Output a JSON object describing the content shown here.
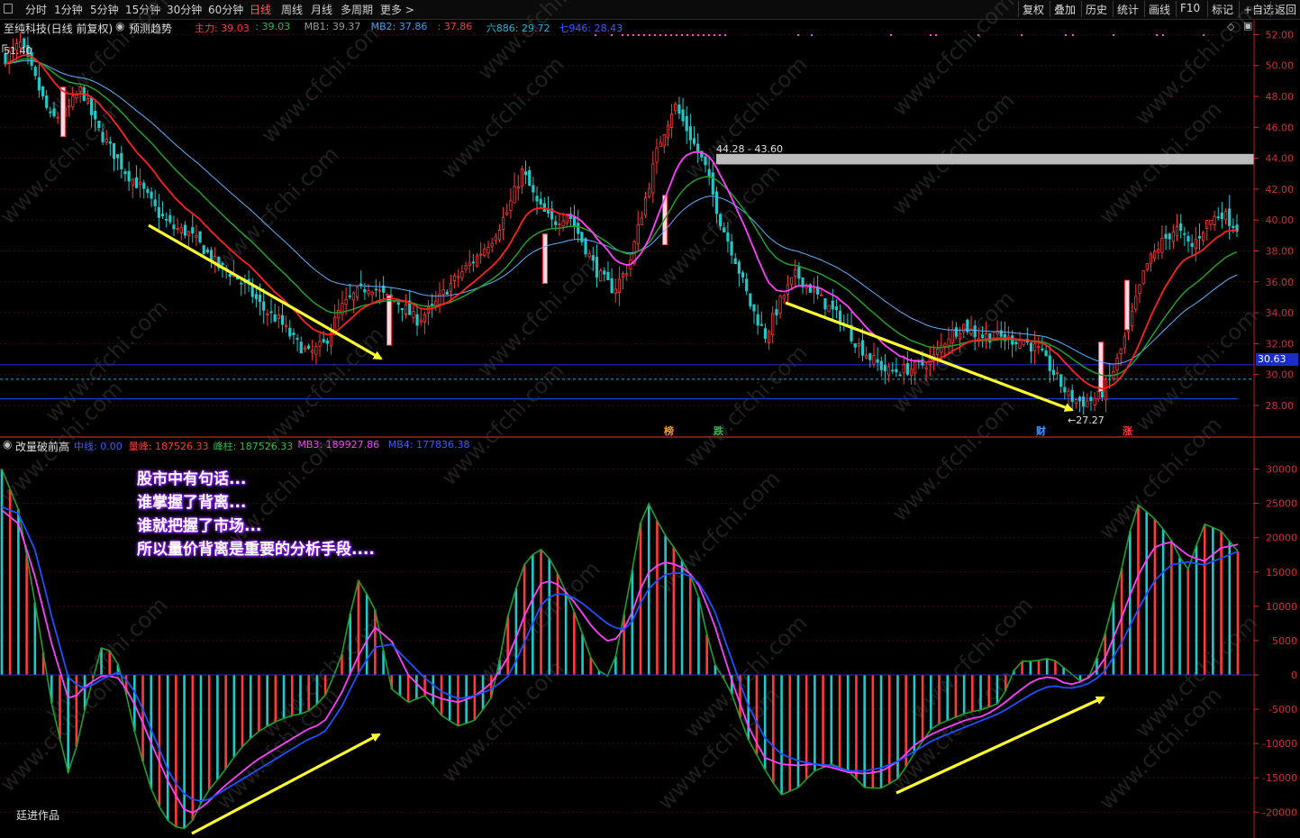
{
  "toolbar": {
    "periods": [
      "分时",
      "1分钟",
      "5分钟",
      "15分钟",
      "30分钟",
      "60分钟",
      "日线",
      "周线",
      "月线",
      "多周期",
      "更多 >"
    ],
    "active_period": "日线",
    "right_buttons": [
      "复权",
      "叠加",
      "历史",
      "统计",
      "画线",
      "F10",
      "标记",
      "+自选",
      "返回"
    ]
  },
  "header": {
    "title": "至纯科技(日线 前复权)",
    "indicator_name": "预测趋势",
    "legend": [
      {
        "label": "主力: 39.03",
        "color": "#ff3a3a"
      },
      {
        "label": ": 39.03",
        "color": "#2ebd4a"
      },
      {
        "label": "MB1: 39.37",
        "color": "#9a9a9a"
      },
      {
        "label": "MB2: 37.86",
        "color": "#3a9cff"
      },
      {
        "label": ": 37.86",
        "color": "#ff3a3a"
      },
      {
        "label": "六886: 29.72",
        "color": "#20b8d8"
      },
      {
        "label": "七946: 28.43",
        "color": "#3a5cff"
      }
    ]
  },
  "lower_header": {
    "title": "改量破前高",
    "legend": [
      {
        "label": "中线: 0.00",
        "color": "#3a5cff"
      },
      {
        "label": "量峰: 187526.33",
        "color": "#ff3a3a"
      },
      {
        "label": "峰柱: 187526.33",
        "color": "#2ebd4a"
      },
      {
        "label": "MB3: 189927.86",
        "color": "#ff40ff"
      },
      {
        "label": "MB4: 177836.38",
        "color": "#3a5cff"
      }
    ]
  },
  "annotations": {
    "text_lines": [
      "股市中有句话...",
      "谁掌握了背离...",
      "谁就把握了市场...",
      "所以量价背离是重要的分析手段...."
    ],
    "watermark": "www.cfchi.com",
    "author": "廷进作品",
    "high_label": "51.40",
    "low_label": "←27.27",
    "zone_label": "44.28 - 43.60",
    "current_price": "30.63",
    "event_markers": [
      {
        "text": "榜",
        "color": "#ff9a2a"
      },
      {
        "text": "跌",
        "color": "#2ebd4a"
      },
      {
        "text": "财",
        "color": "#3a9cff"
      },
      {
        "text": "涨",
        "color": "#ff3a3a"
      }
    ]
  },
  "colors": {
    "up": "#ff3a3a",
    "down": "#20c8c8",
    "ma_green": "#22a02a",
    "ma_red": "#ff2020",
    "ma_magenta": "#ff40ff",
    "ma_blue": "#60b0ff",
    "arrow": "#ffff30",
    "axis": "#d03030",
    "zone": "#bcbcbc"
  },
  "chart_data": [
    {
      "type": "line",
      "subtype": "candlestick",
      "title": "至纯科技(日线 前复权)",
      "ylim": [
        27,
        53
      ],
      "y_ticks": [
        28,
        30,
        32,
        34,
        36,
        38,
        40,
        42,
        44,
        46,
        48,
        50,
        52
      ],
      "key_levels": {
        "high": 51.4,
        "low": 27.27,
        "resistance_zone": [
          43.6,
          44.28
        ],
        "current": 30.63
      },
      "price_path": [
        50.5,
        51.4,
        49,
        46.5,
        47,
        48.5,
        46,
        44.5,
        43,
        42,
        40.5,
        39.5,
        39.2,
        38.2,
        37,
        36.5,
        35.5,
        34.2,
        33.5,
        32.2,
        31.3,
        32,
        34.2,
        35.2,
        35.8,
        35,
        34.6,
        33.5,
        34.2,
        35.5,
        36.6,
        37.6,
        38.8,
        40.5,
        43.2,
        41,
        39.8,
        40.5,
        38.5,
        36.5,
        35.5,
        37,
        41,
        45,
        47.5,
        45.5,
        43.5,
        40,
        37.5,
        34.5,
        32.5,
        34.8,
        36.5,
        35.5,
        34.5,
        33.5,
        32,
        31,
        30.2,
        30.3,
        30.5,
        31,
        32.5,
        33.2,
        32.5,
        32.5,
        32.3,
        32.2,
        31.5,
        30,
        28.5,
        28.2,
        28.6,
        30.5,
        33.5,
        37,
        38.5,
        39.5,
        38.2,
        39.8,
        40.5,
        39.5
      ]
    },
    {
      "type": "bar",
      "title": "改量破前高",
      "ylim": [
        -24000,
        33000
      ],
      "y_ticks": [
        -20000,
        -15000,
        -10000,
        -5000,
        0,
        5000,
        10000,
        15000,
        20000,
        25000,
        30000
      ],
      "values": [
        30000,
        24000,
        10000,
        -5000,
        -15000,
        -4000,
        5000,
        1000,
        -10000,
        -18000,
        -22000,
        -22500,
        -17500,
        -14500,
        -11000,
        -8500,
        -7000,
        -6000,
        -5500,
        -3500,
        2000,
        14000,
        10000,
        -2000,
        -4000,
        -3000,
        -6000,
        -7500,
        -6500,
        -3000,
        10000,
        17000,
        18500,
        14000,
        8000,
        1000,
        -500,
        12000,
        26000,
        21000,
        17500,
        13000,
        2000,
        -2000,
        -9000,
        -13500,
        -17500,
        -16500,
        -14000,
        -13000,
        -14000,
        -16500,
        -16500,
        -15000,
        -11000,
        -7500,
        -6500,
        -5500,
        -5000,
        -4000,
        2000,
        2000,
        2500,
        500,
        -1500,
        4500,
        14000,
        25000,
        23000,
        20000,
        15000,
        22000,
        21000,
        18000
      ],
      "series": [
        {
          "name": "MB3",
          "values": [
            24000,
            22000,
            14000,
            4000,
            -4000,
            -1500,
            0,
            -500,
            -5000,
            -11000,
            -16500,
            -20500,
            -19000,
            -16500,
            -14500,
            -12500,
            -11000,
            -9500,
            -8000,
            -7000,
            -3000,
            2500,
            7000,
            5000,
            0,
            -2500,
            -3500,
            -4000,
            -3000,
            -1000,
            3000,
            9500,
            14000,
            13000,
            10000,
            6500,
            4500,
            7500,
            14500,
            16500,
            16000,
            14000,
            8000,
            0,
            -7000,
            -12000,
            -13000,
            -13200,
            -13000,
            -13500,
            -14200,
            -14400,
            -14000,
            -12500,
            -10000,
            -8500,
            -7500,
            -6500,
            -6000,
            -4500,
            -2500,
            -700,
            -200,
            -1500,
            -800,
            1500,
            7500,
            14000,
            18500,
            19500,
            17500,
            16500,
            18500,
            19000
          ]
        },
        {
          "name": "MB4",
          "values": [
            24500,
            23500,
            18000,
            8000,
            -1000,
            -2000,
            -500,
            500,
            -3000,
            -9000,
            -15000,
            -18000,
            -18500,
            -17000,
            -15500,
            -14000,
            -12500,
            -11000,
            -9500,
            -8500,
            -5000,
            0,
            4000,
            4500,
            2000,
            -500,
            -2500,
            -3500,
            -3000,
            -2000,
            0,
            5500,
            11000,
            12000,
            11000,
            9000,
            7000,
            6500,
            12000,
            14500,
            15000,
            14000,
            10000,
            3000,
            -4000,
            -9000,
            -11500,
            -12500,
            -13000,
            -13200,
            -14000,
            -14000,
            -13500,
            -12500,
            -11000,
            -9500,
            -8500,
            -7500,
            -6500,
            -5500,
            -4000,
            -2500,
            -1500,
            -2000,
            -1500,
            0,
            4000,
            9000,
            13500,
            16000,
            16500,
            16000,
            17000,
            18000
          ]
        }
      ]
    }
  ]
}
